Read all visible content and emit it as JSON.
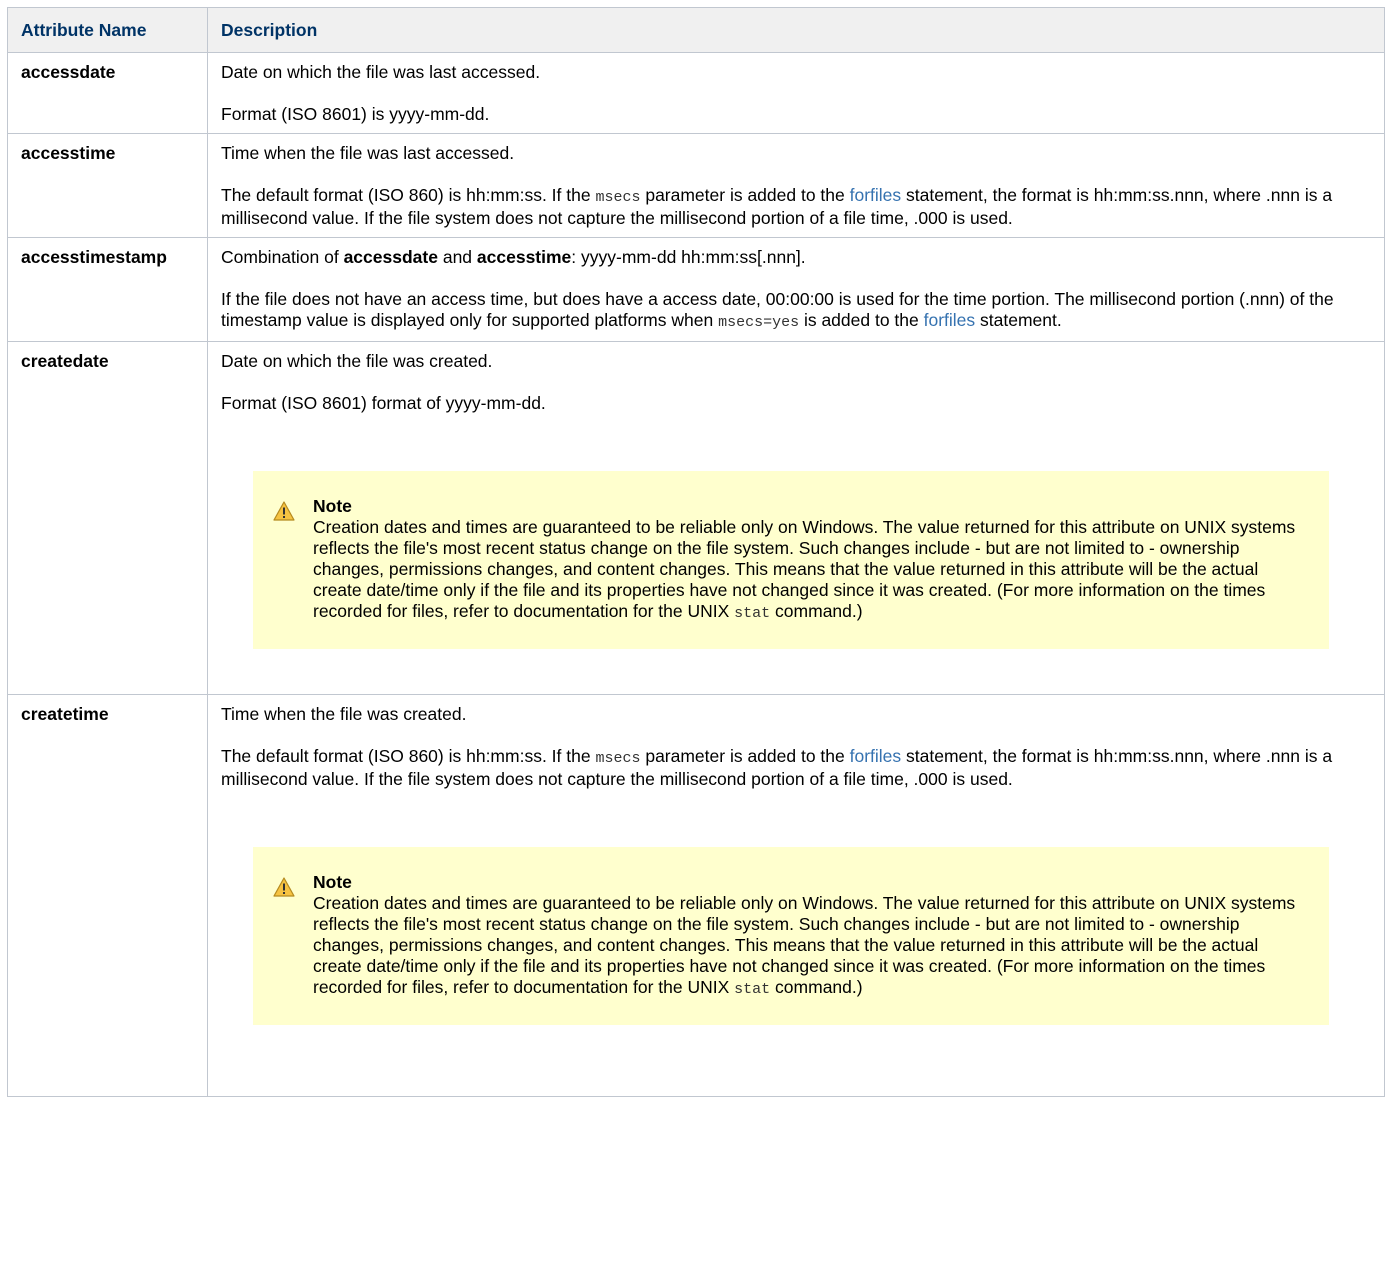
{
  "table": {
    "header": {
      "name": "Attribute Name",
      "description": "Description"
    },
    "rows": {
      "accessdate": {
        "name": "accessdate",
        "p1": "Date on which the file was last accessed.",
        "p2": "Format (ISO 8601) is yyyy-mm-dd."
      },
      "accesstime": {
        "name": "accesstime",
        "p1": "Time when the file was last accessed.",
        "p2_a": "The default format (ISO 860) is hh:mm:ss. If the ",
        "p2_code": "msecs",
        "p2_b": " parameter is added to the ",
        "p2_link": "forfiles",
        "p2_c": " statement, the format is hh:mm:ss.nnn, where .nnn is a millisecond value. If the file system does not capture the millisecond portion of a file time, .000 is used."
      },
      "accesstimestamp": {
        "name": "accesstimestamp",
        "p1_a": "Combination of ",
        "p1_kw1": "accessdate",
        "p1_b": " and ",
        "p1_kw2": "accesstime",
        "p1_c": ": yyyy-mm-dd hh:mm:ss[.nnn].",
        "p2_a": "If the file does not have an access time, but does have a access date, 00:00:00 is used for the time portion. The millisecond portion (.nnn) of the timestamp value is displayed only for supported platforms when ",
        "p2_code": "msecs=yes",
        "p2_b": " is added to the ",
        "p2_link": "forfiles",
        "p2_c": " statement."
      },
      "createdate": {
        "name": "createdate",
        "p1": "Date on which the file was created.",
        "p2": "Format (ISO 8601) format of yyyy-mm-dd.",
        "note_title": "Note",
        "note_a": "Creation dates and times are guaranteed to be reliable only on Windows. The value returned for this attribute on UNIX systems reflects the file's most recent status change on the file system. Such changes include - but are not limited to - ownership changes, permissions changes, and content changes. This means that the value returned in this attribute will be the actual create date/time only if the file and its properties have not changed since it was created. (For more information on the times recorded for files, refer to documentation for the UNIX ",
        "note_code": "stat",
        "note_b": " command.)"
      },
      "createtime": {
        "name": "createtime",
        "p1": "Time when the file was created.",
        "p2_a": "The default format (ISO 860) is hh:mm:ss. If the ",
        "p2_code": "msecs",
        "p2_b": " parameter is added to the ",
        "p2_link": "forfiles",
        "p2_c": " statement, the format is hh:mm:ss.nnn, where .nnn is a millisecond value. If the file system does not capture the millisecond portion of a file time, .000 is used.",
        "note_title": "Note",
        "note_a": "Creation dates and times are guaranteed to be reliable only on Windows. The value returned for this attribute on UNIX systems reflects the file's most recent status change on the file system. Such changes include - but are not limited to - ownership changes, permissions changes, and content changes. This means that the value returned in this attribute will be the actual create date/time only if the file and its properties have not changed since it was created. (For more information on the times recorded for files, refer to documentation for the UNIX ",
        "note_code": "stat",
        "note_b": " command.)"
      }
    }
  },
  "colors": {
    "header_text": "#003366",
    "header_bg": "#f0f0f0",
    "border": "#c1c7d0",
    "link": "#3572b0",
    "note_bg": "#ffffce",
    "warning_icon": "#f6c342"
  },
  "icons": {
    "note": "warning-icon"
  }
}
